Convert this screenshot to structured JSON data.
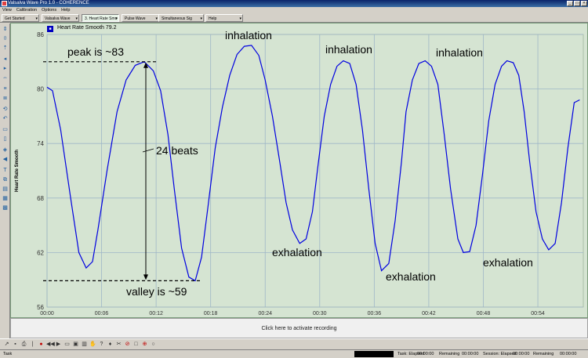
{
  "window": {
    "title": "Valsalva Wave Pro 1.0 - COHERENCE"
  },
  "menu": [
    "View",
    "Calibration",
    "Options",
    "Help"
  ],
  "tabs": [
    {
      "label": "Get Started",
      "active": false
    },
    {
      "label": "Valsalva Wave",
      "active": false
    },
    {
      "label": "3. Heart Rate Smo",
      "active": true
    },
    {
      "label": "Pulse Wave",
      "active": false
    },
    {
      "label": "Simultaneous Sig",
      "active": false
    },
    {
      "label": "Help",
      "active": false
    }
  ],
  "plot": {
    "title_badge": "■",
    "title": "Heart Rate Smooth 79.2",
    "ylabel": "Heart Rate Smooth"
  },
  "chart_data": {
    "type": "line",
    "title": "Heart Rate Smooth 79.2",
    "ylabel": "Heart Rate Smooth",
    "xlabel": "",
    "ylim": [
      56,
      86
    ],
    "xlim": [
      0,
      59
    ],
    "x_ticks": [
      0,
      6,
      12,
      18,
      24,
      30,
      36,
      42,
      48,
      54
    ],
    "x_tick_labels": [
      "00:00",
      "00:06",
      "00:12",
      "00:18",
      "00:24",
      "00:30",
      "00:36",
      "00:42",
      "00:48",
      "00:54"
    ],
    "y_ticks": [
      56,
      62,
      68,
      74,
      80,
      86
    ],
    "grid": true,
    "series": [
      {
        "name": "",
        "color": "#0000e0",
        "x": [
          0,
          0.6,
          1.5,
          2.6,
          3.5,
          4.3,
          5.0,
          5.6,
          6.6,
          7.7,
          8.7,
          9.7,
          10.7,
          11.7,
          12.5,
          13.3,
          14.0,
          14.8,
          15.6,
          16.3,
          17.0,
          17.7,
          18.5,
          19.3,
          20.1,
          20.9,
          21.7,
          22.5,
          23.3,
          24.0,
          24.8,
          25.6,
          26.3,
          27.0,
          27.8,
          28.5,
          29.2,
          29.8,
          30.5,
          31.2,
          31.9,
          32.6,
          33.3,
          34.0,
          34.7,
          35.4,
          36.1,
          36.8,
          37.6,
          38.3,
          39.0,
          39.5,
          40.2,
          40.9,
          41.6,
          42.3,
          43.0,
          43.7,
          44.4,
          45.2,
          45.8,
          46.5,
          47.2,
          47.9,
          48.6,
          49.3,
          50.0,
          50.6,
          51.3,
          51.9,
          52.5,
          53.1,
          53.8,
          54.5,
          55.2,
          55.9,
          56.6,
          57.3,
          58.0,
          58.6
        ],
        "y": [
          80.2,
          79.8,
          75.5,
          68.0,
          62.0,
          60.3,
          61.0,
          64.5,
          71.0,
          77.5,
          81.0,
          82.6,
          83.0,
          82.0,
          79.8,
          75.0,
          69.0,
          62.5,
          59.3,
          58.9,
          61.5,
          67.0,
          73.5,
          78.0,
          81.5,
          83.8,
          84.7,
          84.8,
          83.7,
          81.0,
          77.0,
          72.0,
          67.5,
          64.5,
          63.0,
          63.5,
          66.5,
          71.5,
          77.0,
          80.5,
          82.5,
          83.1,
          82.8,
          80.5,
          75.5,
          69.0,
          63.0,
          60.0,
          60.8,
          65.5,
          72.0,
          77.5,
          81.0,
          82.8,
          83.1,
          82.5,
          80.5,
          75.0,
          69.0,
          63.5,
          62.0,
          62.1,
          65.0,
          70.5,
          76.5,
          80.5,
          82.5,
          83.1,
          82.9,
          81.5,
          77.5,
          72.0,
          66.5,
          63.5,
          62.3,
          63.0,
          67.5,
          73.5,
          78.5,
          78.8
        ]
      }
    ],
    "annotations": [
      "peak is ~83",
      "valley is ~59",
      "24 beats",
      "inhalation",
      "inhalation",
      "inhalation",
      "exhalation",
      "exhalation",
      "exhalation"
    ]
  },
  "record": {
    "label": "Click here to activate recording"
  },
  "status": {
    "task": "Task",
    "task_elapsed_label": "Task: Elapsed",
    "task_elapsed": "00:00:00",
    "task_remaining_label": "Remaining",
    "task_remaining": "00:00:00",
    "session_elapsed_label": "Session: Elapsed",
    "session_elapsed": "00:00:00",
    "session_remaining_label": "Remaining",
    "session_remaining": "00:00:00"
  }
}
